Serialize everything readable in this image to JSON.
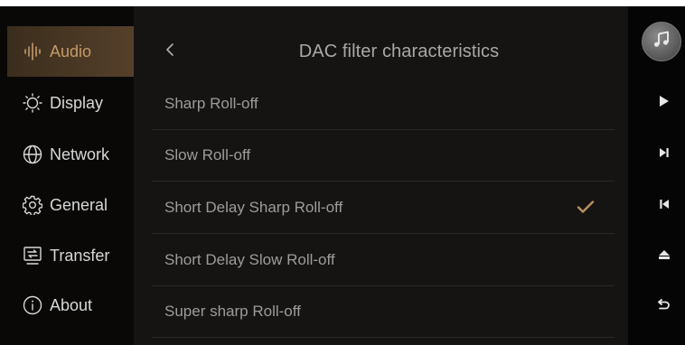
{
  "sidebar": {
    "items": [
      {
        "label": "Audio",
        "icon": "audio-bars-icon",
        "active": true
      },
      {
        "label": "Display",
        "icon": "brightness-icon",
        "active": false
      },
      {
        "label": "Network",
        "icon": "globe-icon",
        "active": false
      },
      {
        "label": "General",
        "icon": "gear-icon",
        "active": false
      },
      {
        "label": "Transfer",
        "icon": "transfer-icon",
        "active": false
      },
      {
        "label": "About",
        "icon": "info-icon",
        "active": false
      }
    ]
  },
  "main": {
    "title": "DAC filter characteristics",
    "back_icon": "chevron-left-icon",
    "options": [
      {
        "label": "Sharp Roll-off",
        "selected": false
      },
      {
        "label": "Slow Roll-off",
        "selected": false
      },
      {
        "label": "Short Delay Sharp Roll-off",
        "selected": true
      },
      {
        "label": "Short Delay Slow Roll-off",
        "selected": false
      },
      {
        "label": "Super sharp Roll-off",
        "selected": false
      }
    ]
  },
  "controls": {
    "album": "music-note-icon",
    "buttons": [
      "play-icon",
      "next-track-icon",
      "previous-track-icon",
      "eject-icon",
      "return-icon"
    ]
  },
  "colors": {
    "accent": "#c49a68",
    "check": "#b98f5e"
  }
}
